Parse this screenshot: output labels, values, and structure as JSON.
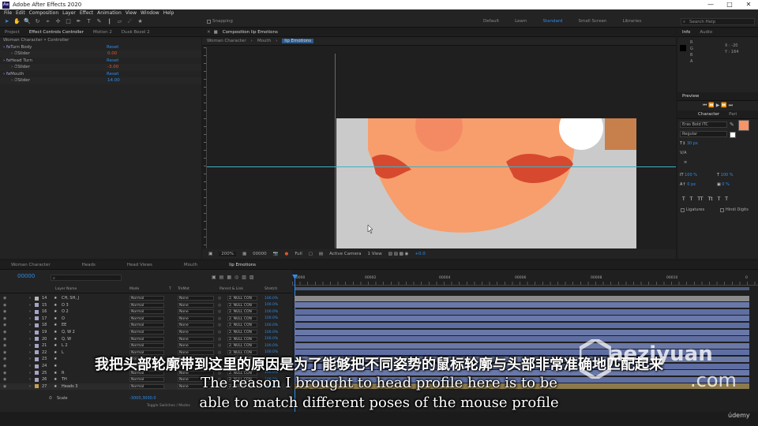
{
  "app": {
    "title": "Adobe After Effects 2020",
    "menu": [
      "File",
      "Edit",
      "Composition",
      "Layer",
      "Effect",
      "Animation",
      "View",
      "Window",
      "Help"
    ],
    "window_controls": [
      "—",
      "□",
      "✕"
    ]
  },
  "toolbar": {
    "snapping": "Snapping",
    "workspaces": [
      "Default",
      "Learn",
      "Standard",
      "Small Screen",
      "Libraries"
    ],
    "active_workspace": "Standard",
    "search_help": "Search Help",
    "tools": [
      "selection-tool",
      "hand-tool",
      "zoom-tool",
      "rotate-tool",
      "camera-tool",
      "pan-behind-tool",
      "rectangle-tool",
      "pen-tool",
      "type-tool",
      "brush-tool",
      "clone-stamp-tool",
      "eraser-tool",
      "roto-brush-tool",
      "puppet-tool"
    ]
  },
  "left_panel": {
    "tabs": [
      "Project",
      "Effect Controls Controller",
      "Motion 2",
      "Dusk Bezel 2"
    ],
    "breadcrumb": "Woman Character • Controller",
    "effects": [
      {
        "name": "Turn Body",
        "reset": "Reset"
      },
      {
        "name": "Slider",
        "value": "0.00",
        "color": "#e0552c",
        "indent": true
      },
      {
        "name": "Head Turn",
        "reset": "Reset"
      },
      {
        "name": "Slider",
        "value": "-3.00",
        "color": "#e0552c",
        "indent": true
      },
      {
        "name": "Mouth",
        "reset": "Reset"
      },
      {
        "name": "Slider",
        "value": "14.00",
        "color": "#2d8ceb",
        "indent": true
      }
    ]
  },
  "composition": {
    "tab_title": "Composition lip Emotions",
    "breadcrumbs": [
      "Woman Character",
      "Mouth",
      "lip Emotions"
    ],
    "zoom": "200%",
    "timecode": "00000",
    "resolution": "Full",
    "camera": "Active Camera",
    "view": "1 View",
    "exposure": "+0.0"
  },
  "right_panel": {
    "info_tabs": [
      "Info",
      "Audio"
    ],
    "info": {
      "r": "R",
      "g": "G",
      "b": "B",
      "a": "A",
      "x": "X : -20",
      "y": "Y : 164"
    },
    "preview_label": "Preview",
    "char_tabs": [
      "Character",
      "Pari"
    ],
    "font": "Eras Bold ITC",
    "style": "Regular",
    "size": "30 px",
    "leading": "",
    "tracking": "",
    "vscale": "100 %",
    "hscale": "100 %",
    "baseline": "0 px",
    "tsume": "0 %",
    "ligatures": "Ligatures",
    "hindi_digits": "Hindi Digits",
    "text_styles": [
      "T",
      "T",
      "TT",
      "Tt",
      "T",
      "T"
    ],
    "fill_color": "#f79468"
  },
  "timeline": {
    "tabs": [
      "Woman Character",
      "Heads",
      "Head Views",
      "Mouth",
      "lip Emotions"
    ],
    "active_tab": "lip Emotions",
    "timecode": "00000",
    "columns": {
      "layer_name": "Layer Name",
      "mode": "Mode",
      "t": "T",
      "trkmat": "TrkMat",
      "parent": "Parent & Link",
      "stretch": "Stretch"
    },
    "ruler_marks": [
      "00000",
      "00002",
      "00004",
      "00006",
      "00008",
      "00010",
      "0"
    ],
    "layers": [
      {
        "num": "14",
        "name": "CH, SH, J",
        "swatch": "#b5b5b5"
      },
      {
        "num": "15",
        "name": "O 3",
        "swatch": "#a4a4c6"
      },
      {
        "num": "16",
        "name": "O 2",
        "swatch": "#a4a4c6"
      },
      {
        "num": "17",
        "name": "O",
        "swatch": "#a4a4c6"
      },
      {
        "num": "18",
        "name": "EE",
        "swatch": "#a4a4c6"
      },
      {
        "num": "19",
        "name": "Q, W 2",
        "swatch": "#a4a4c6"
      },
      {
        "num": "20",
        "name": "Q, W",
        "swatch": "#a4a4c6"
      },
      {
        "num": "21",
        "name": "L 2",
        "swatch": "#a4a4c6"
      },
      {
        "num": "22",
        "name": "L",
        "swatch": "#a4a4c6"
      },
      {
        "num": "23",
        "name": "",
        "swatch": "#a4a4c6"
      },
      {
        "num": "24",
        "name": "",
        "swatch": "#a4a4c6"
      },
      {
        "num": "25",
        "name": "R",
        "swatch": "#a4a4c6"
      },
      {
        "num": "26",
        "name": "TH",
        "swatch": "#a4a4c6"
      },
      {
        "num": "27",
        "name": "Heads 3",
        "swatch": "#c89f4a"
      }
    ],
    "layer_mode": "Normal",
    "layer_trkmat": "None",
    "layer_parent": "2. NULL CON",
    "layer_stretch": "100.0%",
    "scale_prop": "Scale",
    "scale_value": "-3000,3000.0",
    "toggle": "Toggle Switches / Modes"
  },
  "subtitles": {
    "cn": "我把头部轮廓带到这里的原因是为了能够把不同姿势的鼠标轮廓与头部非常准确地匹配起来",
    "en_line1": "The reason I brought to head profile here is to be",
    "en_line2": "able to match different poses of the mouse profile"
  },
  "watermark": {
    "top": "aeziyuan",
    "bottom": ".com"
  },
  "udemy": "údemy"
}
